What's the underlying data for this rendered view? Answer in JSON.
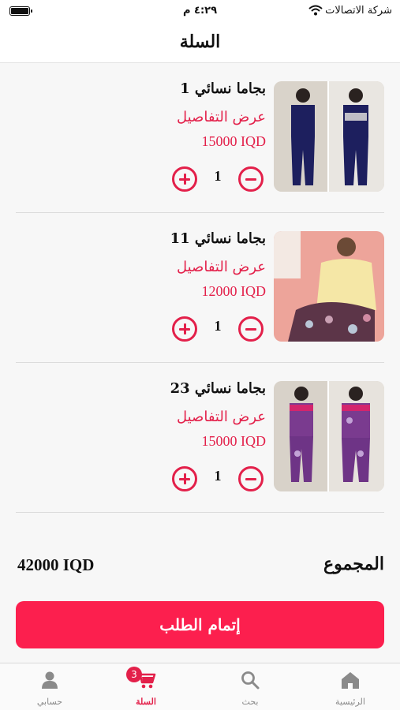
{
  "status_bar": {
    "carrier": "شركة الاتصالات",
    "time": "٤:٢٩ م"
  },
  "header": {
    "title": "السلة"
  },
  "cart": {
    "items": [
      {
        "name": "بجاما نسائي 1",
        "details_label": "عرض التفاصيل",
        "price": "15000 IQD",
        "quantity": "1"
      },
      {
        "name": "بجاما نسائي 11",
        "details_label": "عرض التفاصيل",
        "price": "12000 IQD",
        "quantity": "1"
      },
      {
        "name": "بجاما نسائي 23",
        "details_label": "عرض التفاصيل",
        "price": "15000 IQD",
        "quantity": "1"
      }
    ]
  },
  "summary": {
    "total_label": "المجموع",
    "total_value": "42000 IQD",
    "checkout_label": "إتمام الطلب"
  },
  "tab_bar": {
    "tabs": [
      {
        "label": "الرئيسية",
        "icon": "home-icon"
      },
      {
        "label": "بحث",
        "icon": "search-icon"
      },
      {
        "label": "السلة",
        "icon": "cart-icon",
        "badge": "3",
        "active": true
      },
      {
        "label": "حسابي",
        "icon": "person-icon"
      }
    ]
  },
  "colors": {
    "accent": "#e3204a",
    "checkout_button": "#fc1f4e",
    "background": "#f7f7f7"
  }
}
